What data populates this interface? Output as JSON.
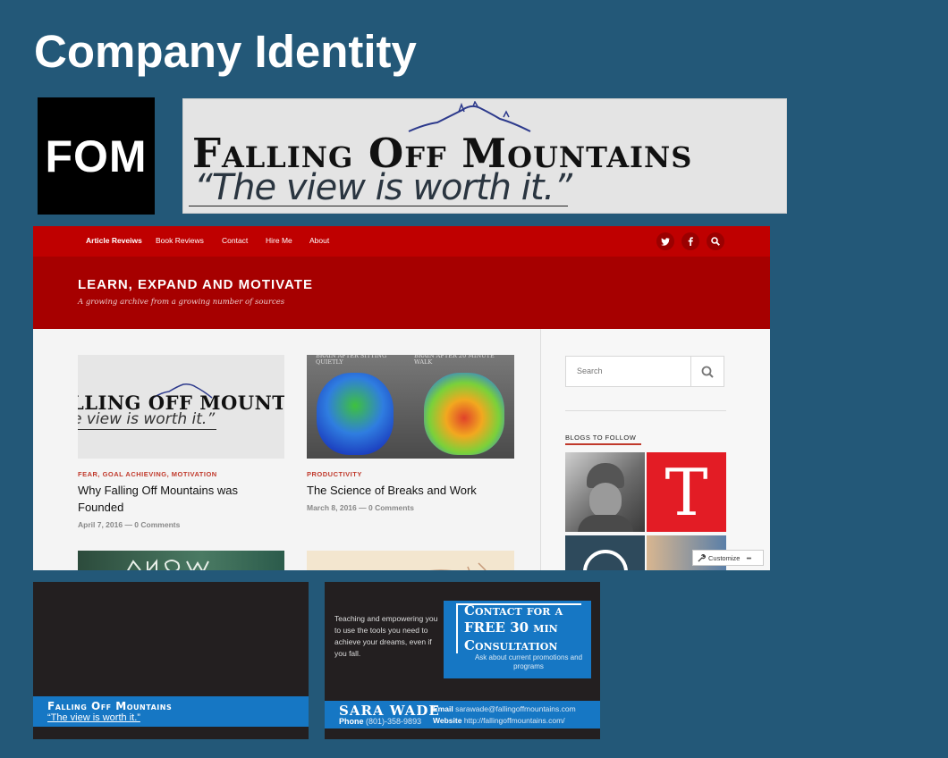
{
  "title": "Company Identity",
  "fom_box": {
    "text": "FOM"
  },
  "logo": {
    "name": "Falling Off Mountains",
    "tagline": "“The view is worth it.”"
  },
  "website": {
    "nav": [
      "Article Reveiws",
      "Book Reviews",
      "Contact",
      "Hire Me",
      "About"
    ],
    "social_icons": [
      "twitter-icon",
      "facebook-icon",
      "search-icon"
    ],
    "hero": {
      "title": "LEARN, EXPAND AND MOTIVATE",
      "subtitle": "A growing archive from a growing number of sources"
    },
    "posts": [
      {
        "thumb_line1": "LLING OFF MOUNTAI",
        "thumb_line2": "e view is worth it.”",
        "categories": "FEAR, GOAL ACHIEVING, MOTIVATION",
        "title": "Why Falling Off Mountains was Founded",
        "meta": "April 7, 2016 — 0 Comments"
      },
      {
        "thumb_label_left": "BRAIN AFTER SITTING QUIETLY",
        "thumb_label_right": "BRAIN AFTER 20 MINUTE WALK",
        "categories": "PRODUCTIVITY",
        "title": "The Science of Breaks and Work",
        "meta": "March 8, 2016 — 0 Comments"
      }
    ],
    "sidebar": {
      "search_placeholder": "Search",
      "blogs_heading": "BLOGS TO FOLLOW",
      "tile_letter": "T"
    },
    "customize_label": "Customize",
    "customize_dots": "•••"
  },
  "card_front": {
    "name": "Falling Off Mountains",
    "tagline": "“The view is worth it.”"
  },
  "card_back": {
    "blurb": "Teaching and empowering you to use the tools you need to achieve your dreams, even if you fall.",
    "cta_line1": "Contact for a",
    "cta_line2_bold": "FREE",
    "cta_line2_rest": " 30 min",
    "cta_line3": "Consultation",
    "cta_sub": "Ask about current promotions and programs",
    "name": "SARA WADE",
    "phone_label": "Phone",
    "phone": "(801)-358-9893",
    "email_label": "Email",
    "email": "sarawade@fallingoffmountains.com",
    "website_label": "Website",
    "website": "http://fallingoffmountains.com/"
  },
  "colors": {
    "background": "#235878",
    "nav_red": "#bf0000",
    "hero_red": "#a60000",
    "card_blue": "#1677c4"
  }
}
